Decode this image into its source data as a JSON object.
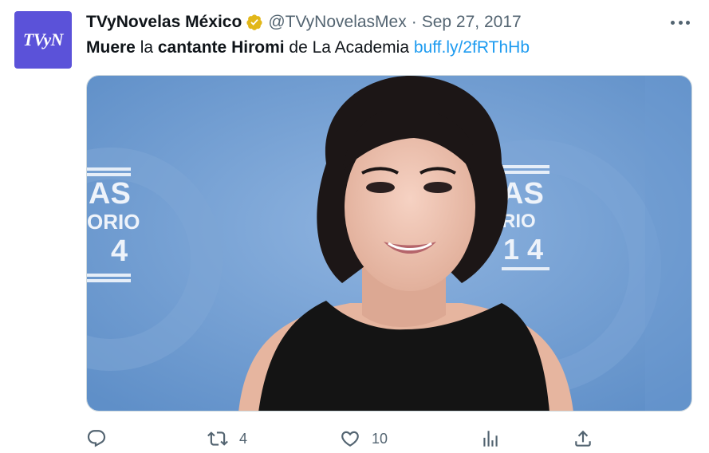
{
  "tweet": {
    "avatar_text": "TVyN",
    "display_name": "TVyNovelas México",
    "handle": "@TVyNovelasMex",
    "separator": "·",
    "date": "Sep 27, 2017",
    "text_parts": {
      "p1": "Muere",
      "p2": " la ",
      "p3": "cantante Hiromi",
      "p4": " de La Academia ",
      "link": "buff.ly/2fRThHb"
    },
    "backdrop_text": {
      "left_line1": "AS",
      "left_line2": "ORIO",
      "left_line3": "4",
      "right_line1": "AS",
      "right_line2": "RIO",
      "right_line3": "1 4"
    }
  },
  "actions": {
    "reply_icon": "reply-icon",
    "retweet_icon": "retweet-icon",
    "retweet_count": "4",
    "like_icon": "heart-icon",
    "like_count": "10",
    "views_icon": "analytics-icon",
    "share_icon": "share-icon"
  },
  "colors": {
    "link": "#1d9bf0",
    "muted": "#536471",
    "avatar_bg": "#5b52d9",
    "verified_badge": "#e2b719",
    "media_bg": "#6f9fd2"
  }
}
